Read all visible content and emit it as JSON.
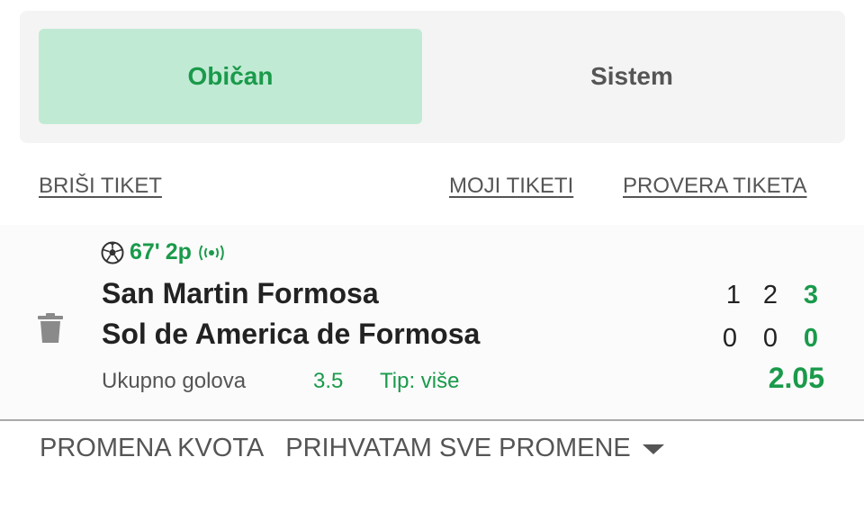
{
  "tabs": {
    "active_label": "Običan",
    "inactive_label": "Sistem"
  },
  "links": {
    "delete": "BRIŠI TIKET",
    "my_tickets": "MOJI TIKETI",
    "check": "PROVERA TIKETA"
  },
  "match": {
    "minute": "67'",
    "period": "2p",
    "home_team": "San Martin Formosa",
    "away_team": "Sol de America de Formosa",
    "home_scores": [
      "1",
      "2",
      "3"
    ],
    "away_scores": [
      "0",
      "0",
      "0"
    ],
    "market_name": "Ukupno golova",
    "line": "3.5",
    "tip": "Tip: više",
    "odd": "2.05"
  },
  "odds_change": {
    "label": "PROMENA KVOTA",
    "value": "PRIHVATAM SVE PROMENE"
  },
  "colors": {
    "accent": "#1a9a4b",
    "tab_active_bg": "#c1ead4",
    "muted_text": "#555555",
    "body_text": "#222222"
  },
  "icons": [
    "soccer-ball-icon",
    "live-broadcast-icon",
    "trash-icon",
    "caret-down-icon"
  ]
}
